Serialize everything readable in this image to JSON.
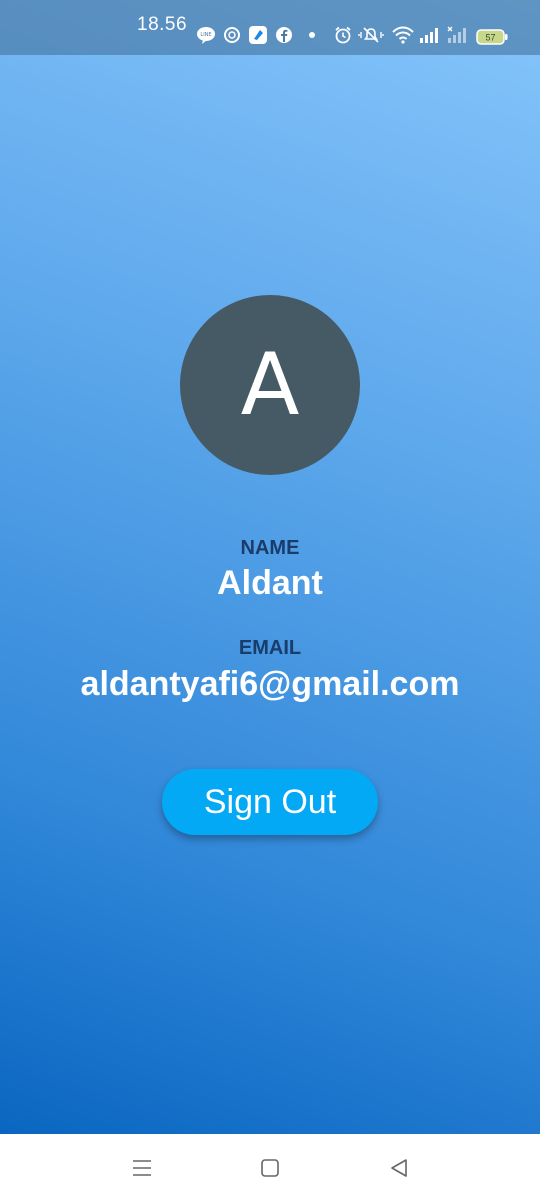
{
  "status_bar": {
    "time": "18.56",
    "battery": "57",
    "icons": [
      "line-icon",
      "chat-icon",
      "app-icon",
      "facebook-icon",
      "notification-dot-icon",
      "alarm-icon",
      "vibrate-icon",
      "wifi-icon",
      "signal-icon",
      "signal-icon",
      "battery-icon"
    ]
  },
  "profile": {
    "avatar_letter": "A",
    "name_label": "NAME",
    "name": "Aldant",
    "email_label": "EMAIL",
    "email": "aldantyafi6@gmail.com"
  },
  "actions": {
    "sign_out_label": "Sign Out"
  },
  "nav_bar": {
    "icons": [
      "menu-icon",
      "home-icon",
      "back-icon"
    ]
  },
  "colors": {
    "avatar_bg": "#455a64",
    "button_bg": "#03a9f4",
    "label_color": "#1a3c6b",
    "gradient_top": "#86c5fb",
    "gradient_bottom": "#0a66c0"
  }
}
